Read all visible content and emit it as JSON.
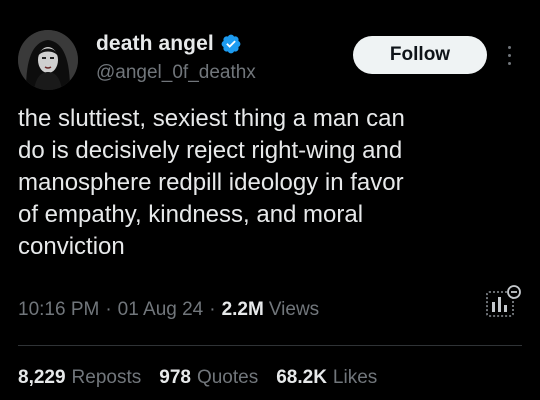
{
  "author": {
    "display_name": "death angel",
    "handle": "@angel_0f_deathx",
    "verified": true,
    "verified_color": "#1d9bf0"
  },
  "follow_button": {
    "label": "Follow"
  },
  "more_menu": {
    "icon": "more-vertical-icon"
  },
  "tweet": {
    "text": "the sluttiest, sexiest thing a man can\ndo is decisively reject right-wing and\nmanosphere redpill ideology in favor\nof empathy, kindness, and moral\nconviction"
  },
  "meta": {
    "time": "10:16 PM",
    "separator": "·",
    "date": "01 Aug 24",
    "views_count": "2.2M",
    "views_label": "Views"
  },
  "analytics": {
    "icon": "analytics-icon"
  },
  "stats": {
    "reposts": {
      "count": "8,229",
      "label": "Reposts"
    },
    "quotes": {
      "count": "978",
      "label": "Quotes"
    },
    "likes": {
      "count": "68.2K",
      "label": "Likes"
    }
  },
  "colors": {
    "background": "#000000",
    "text_primary": "#e7e9ea",
    "text_secondary": "#71767b",
    "follow_bg": "#eff3f4"
  }
}
